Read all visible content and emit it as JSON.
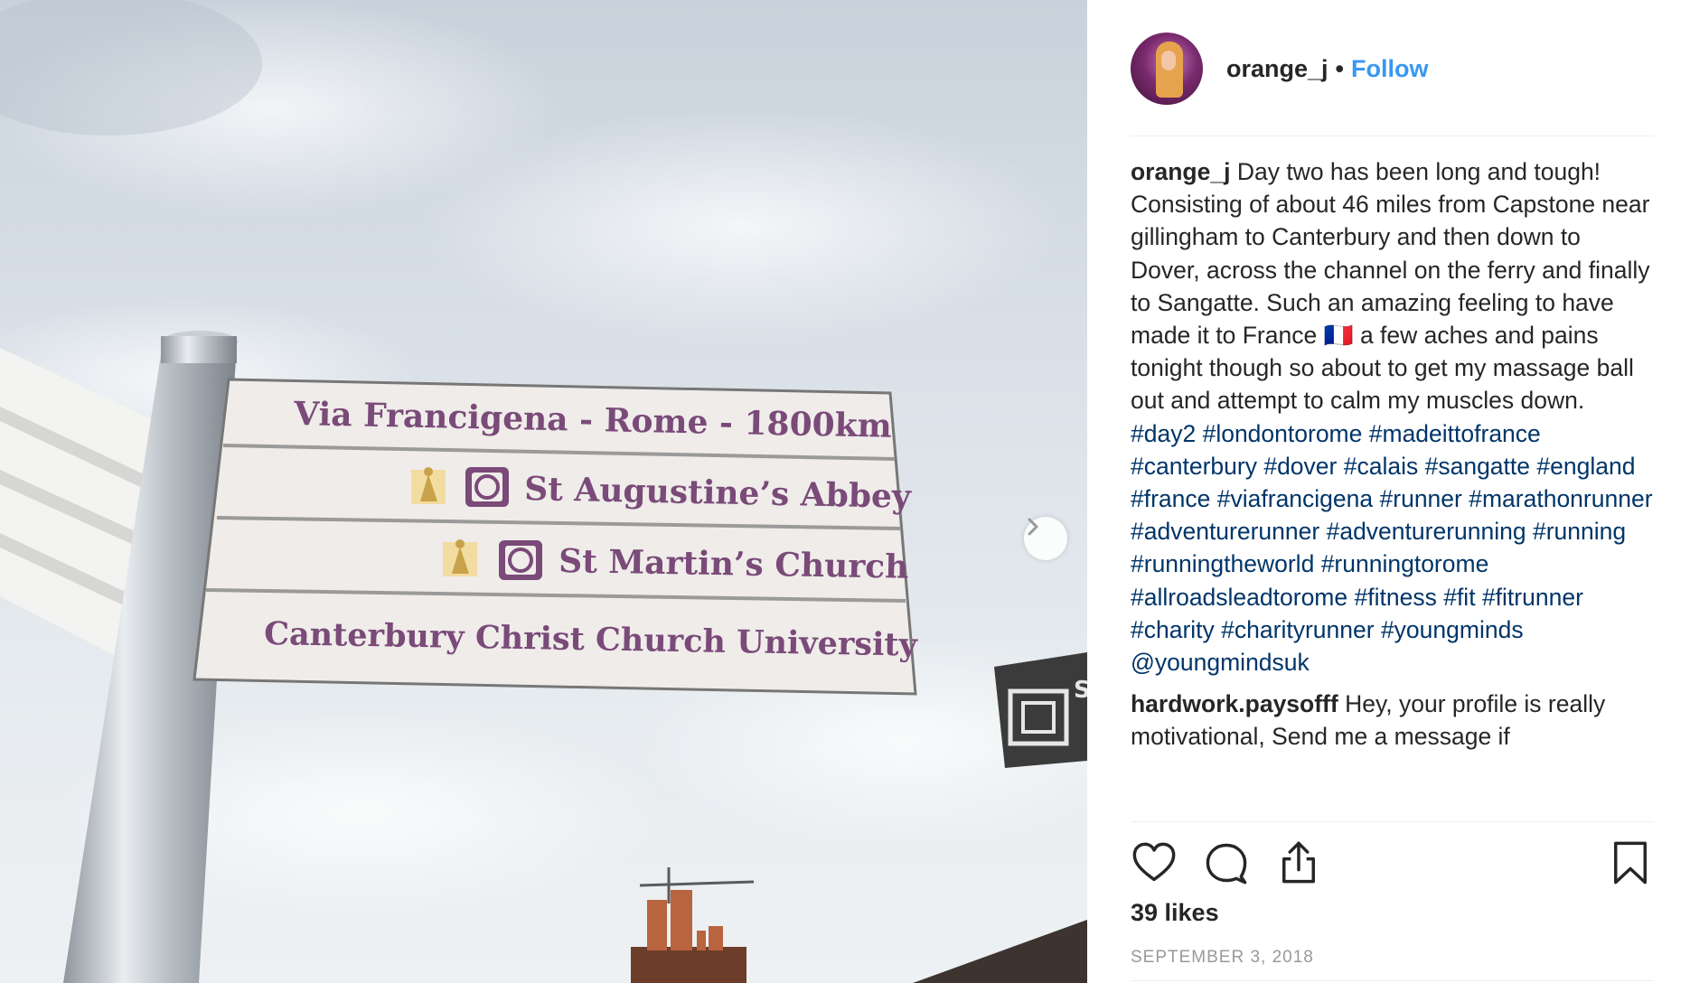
{
  "header": {
    "username": "orange_j",
    "separator": "•",
    "follow_label": "Follow"
  },
  "media": {
    "sign": {
      "line1": "Via Francigena - Rome - 1800km",
      "line2": "St Augustine’s Abbey",
      "line3": "St Martin’s Church",
      "line4": "Canterbury Christ Church University",
      "small_sign_letter": "S"
    }
  },
  "caption": {
    "username": "orange_j",
    "text": "Day two has been long and tough! Consisting of about 46 miles from Capstone near gillingham to Canterbury and then down to Dover, across the channel on the ferry and finally to Sangatte. Such an amazing feeling to have made it to France",
    "flag": "🇫🇷",
    "text2": "a few aches and pains tonight though so about to get my massage ball out and attempt to calm my muscles down.",
    "tags": [
      "#day2",
      "#londontorome",
      "#madeittofrance",
      "#canterbury",
      "#dover",
      "#calais",
      "#sangatte",
      "#england",
      "#france",
      "#viafrancigena",
      "#runner",
      "#marathonrunner",
      "#adventurerunner",
      "#adventurerunning",
      "#running",
      "#runningtheworld",
      "#runningtorome",
      "#allroadsleadtorome",
      "#fitness",
      "#fit",
      "#fitrunner",
      "#charity",
      "#charityrunner",
      "#youngminds"
    ],
    "mention": "@youngmindsuk"
  },
  "comment": {
    "username": "hardwork.paysofff",
    "text": "Hey, your profile is really motivational, Send me a message if"
  },
  "stats": {
    "likes": "39 likes",
    "date": "September 3, 2018"
  },
  "icons": {
    "like": "heart-icon",
    "comment": "comment-icon",
    "share": "share-icon",
    "save": "bookmark-icon",
    "next": "chevron-right-icon"
  },
  "colors": {
    "link": "#3897f0",
    "hashtag": "#003569",
    "sign_text": "#7a4a78",
    "date": "#999999"
  }
}
